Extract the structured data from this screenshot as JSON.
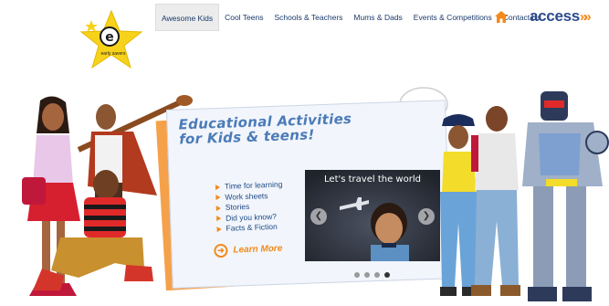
{
  "logo": {
    "letter": "e",
    "tagline": "early savers"
  },
  "nav": {
    "items": [
      {
        "label": "Awesome Kids",
        "active": true
      },
      {
        "label": "Cool Teens",
        "active": false
      },
      {
        "label": "Schools & Teachers",
        "active": false
      },
      {
        "label": "Mums & Dads",
        "active": false
      },
      {
        "label": "Events & Competitions",
        "active": false
      },
      {
        "label": "Contact Us",
        "active": false
      }
    ],
    "home_icon": "home-icon"
  },
  "brand": {
    "name": "access",
    "chevrons": "»»"
  },
  "hero": {
    "title": "Educational Activities for Kids & teens!",
    "bullets": [
      "Time for learning",
      "Work sheets",
      "Stories",
      "Did you know?",
      "Facts & Fiction"
    ],
    "learn_more": "Learn More",
    "slide_caption": "Let's travel the world",
    "prev_icon": "chevron-left-icon",
    "next_icon": "chevron-right-icon",
    "slides_count": 4,
    "active_slide": 4
  },
  "colors": {
    "accent": "#f28a1a",
    "navy": "#1a3a6b",
    "brand_blue": "#2b4a8c",
    "title_blue": "#4b7bb8"
  }
}
